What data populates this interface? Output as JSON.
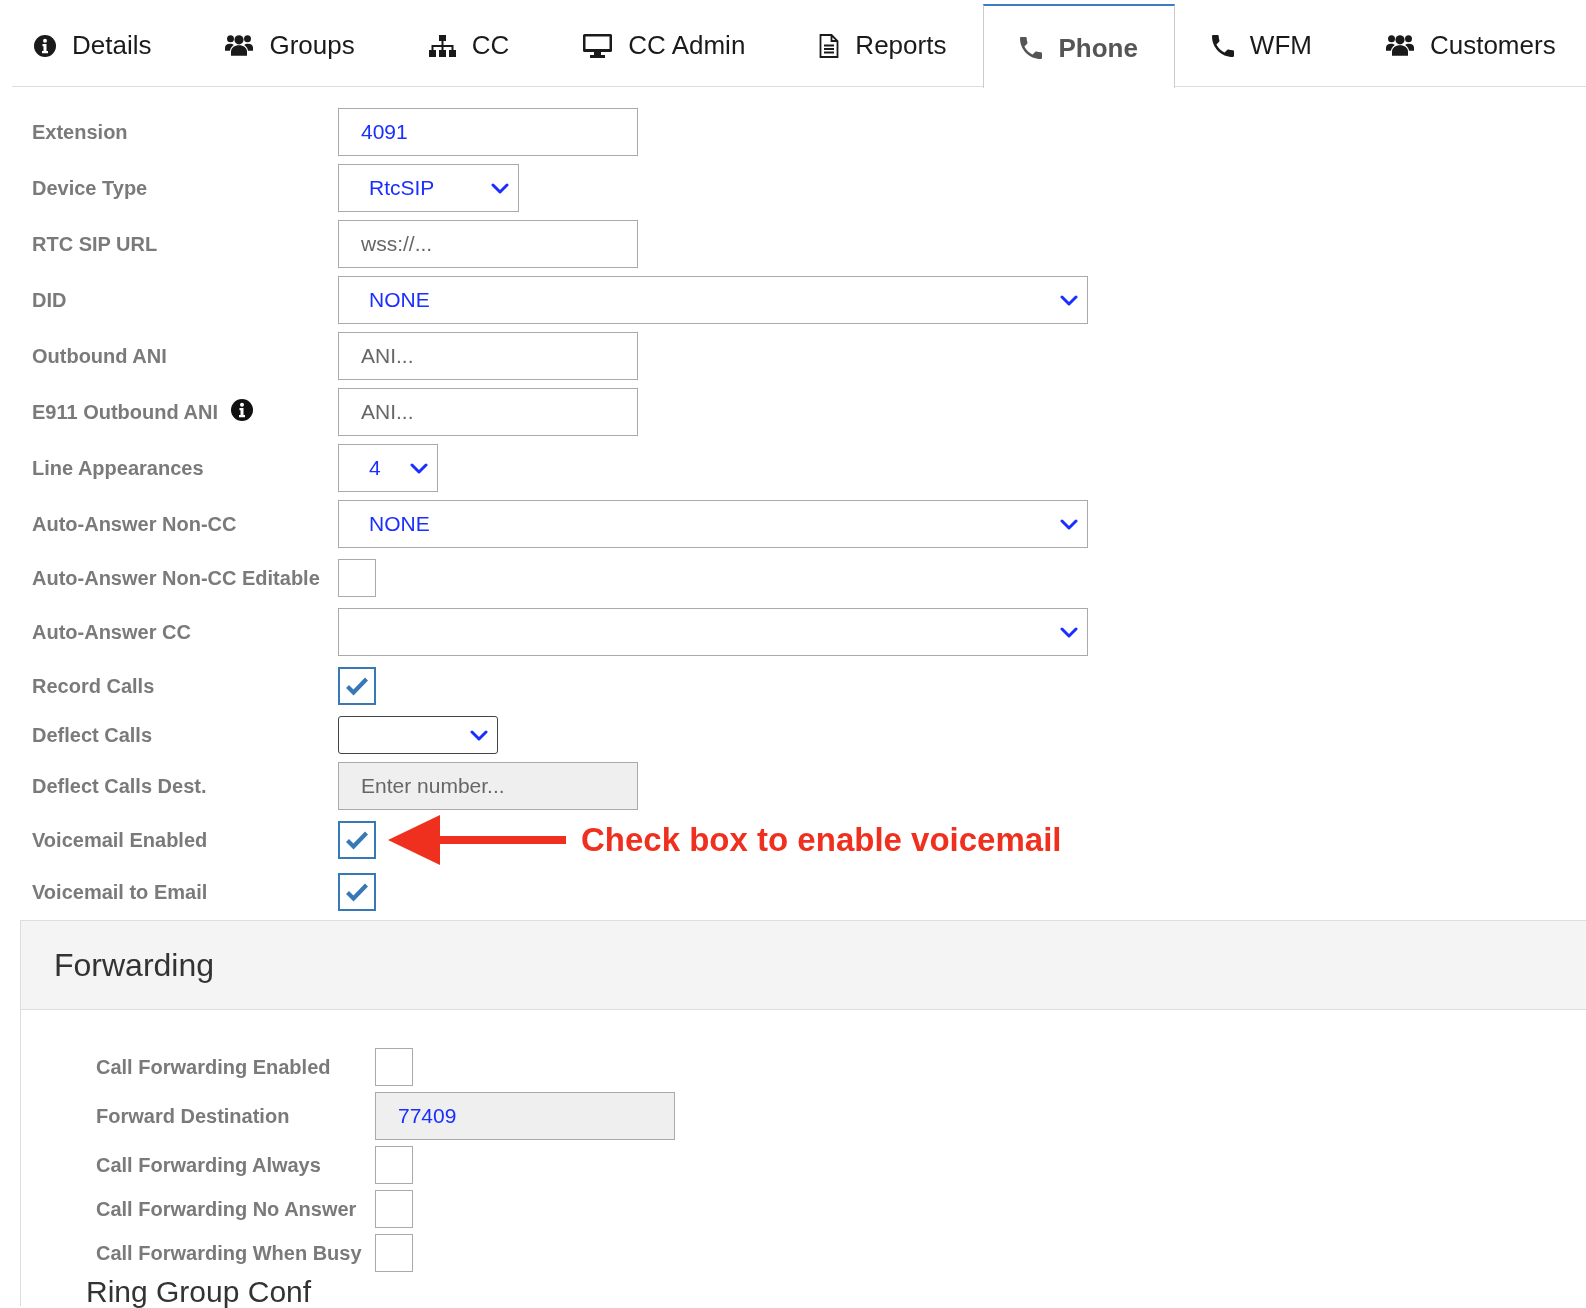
{
  "tabs": [
    {
      "label": "Details",
      "selected": false
    },
    {
      "label": "Groups",
      "selected": false
    },
    {
      "label": "CC",
      "selected": false
    },
    {
      "label": "CC Admin",
      "selected": false
    },
    {
      "label": "Reports",
      "selected": false
    },
    {
      "label": "Phone",
      "selected": true
    },
    {
      "label": "WFM",
      "selected": false
    },
    {
      "label": "Customers",
      "selected": false
    }
  ],
  "phone_form": {
    "fields": [
      {
        "label": "Extension",
        "kind": "text",
        "value": "4091",
        "disabled": false,
        "info_icon": false
      },
      {
        "label": "Device Type",
        "kind": "dropdown",
        "value": "RtcSIP",
        "info_icon": false
      },
      {
        "label": "RTC SIP URL",
        "kind": "text",
        "placeholder": "wss://...",
        "disabled": false,
        "info_icon": false
      },
      {
        "label": "DID",
        "kind": "dropdown",
        "value": "NONE",
        "info_icon": false
      },
      {
        "label": "Outbound ANI",
        "kind": "text",
        "placeholder": "ANI...",
        "disabled": false,
        "info_icon": false
      },
      {
        "label": "E911 Outbound ANI",
        "kind": "text",
        "placeholder": "ANI...",
        "disabled": false,
        "info_icon": true
      },
      {
        "label": "Line Appearances",
        "kind": "dropdown",
        "value": "4",
        "info_icon": false
      },
      {
        "label": "Auto-Answer Non-CC",
        "kind": "dropdown",
        "value": "NONE",
        "info_icon": false
      },
      {
        "label": "Auto-Answer Non-CC Editable",
        "kind": "checkbox",
        "checked": false,
        "info_icon": false
      },
      {
        "label": "Auto-Answer CC",
        "kind": "dropdown",
        "info_icon": false
      },
      {
        "label": "Record Calls",
        "kind": "checkbox",
        "checked": true,
        "info_icon": false
      },
      {
        "label": "Deflect Calls",
        "kind": "dropdown",
        "info_icon": false
      },
      {
        "label": "Deflect Calls Dest.",
        "kind": "text",
        "placeholder": "Enter number...",
        "disabled": true,
        "info_icon": false
      },
      {
        "label": "Voicemail Enabled",
        "kind": "checkbox",
        "checked": true,
        "info_icon": false,
        "annotation": "Check box to enable voicemail"
      },
      {
        "label": "Voicemail to Email",
        "kind": "checkbox",
        "checked": true,
        "info_icon": false
      }
    ]
  },
  "forwarding": {
    "title": "Forwarding",
    "fields": [
      {
        "label": "Call Forwarding Enabled",
        "kind": "checkbox",
        "checked": false
      },
      {
        "label": "Forward Destination",
        "kind": "text",
        "value": "77409",
        "disabled": true
      },
      {
        "label": "Call Forwarding Always",
        "kind": "checkbox",
        "checked": false
      },
      {
        "label": "Call Forwarding No Answer",
        "kind": "checkbox",
        "checked": false
      },
      {
        "label": "Call Forwarding When Busy",
        "kind": "checkbox",
        "checked": false
      }
    ]
  },
  "next_section": {
    "title": "Ring Group Conf"
  }
}
